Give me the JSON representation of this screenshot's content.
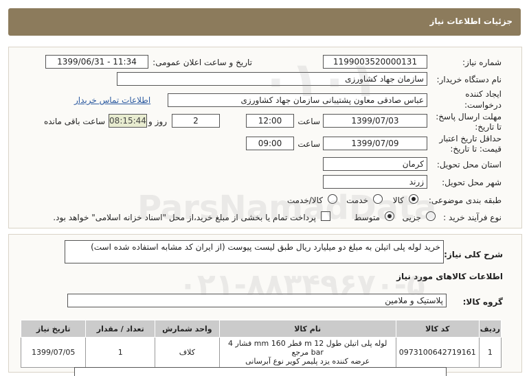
{
  "header": {
    "title": "جزئیات اطلاعات نیاز"
  },
  "form": {
    "need_number_label": "شماره نیاز:",
    "need_number": "1199003520000131",
    "announce_label": "تاریخ و ساعت اعلان عمومی:",
    "announce_value": "1399/06/31 - 11:34",
    "buyer_label": "نام دستگاه خریدار:",
    "buyer_value": "سازمان جهاد کشاورزی",
    "creator_label_1": "ایجاد کننده",
    "creator_label_2": "درخواست:",
    "creator_value": "عباس صادقی معاون پشتیبانی سازمان جهاد کشاورزی",
    "contact_link": "اطلاعات تماس خریدار",
    "deadline_label_1": "مهلت ارسال پاسخ:",
    "deadline_label_2": "تا تاریخ:",
    "deadline_date": "1399/07/03",
    "time_label": "ساعت",
    "deadline_time": "12:00",
    "days_value": "2",
    "days_label": "روز و",
    "remaining_time": "08:15:44",
    "remaining_label": "ساعت باقی مانده",
    "validity_label_1": "حداقل تاریخ اعتبار",
    "validity_label_2": "قیمت: تا تاریخ:",
    "validity_date": "1399/07/09",
    "validity_time": "09:00",
    "province_label": "استان محل تحویل:",
    "province_value": "کرمان",
    "city_label": "شهر محل تحویل:",
    "city_value": "زرند",
    "category_label": "طبقه بندی موضوعی:",
    "category_options": [
      "کالا",
      "خدمت",
      "کالا/خدمت"
    ],
    "category_selected": "کالا",
    "process_label": "نوع فرآیند خرید :",
    "process_options": [
      "جزیی",
      "متوسط"
    ],
    "process_selected": "متوسط",
    "payment_note": "پرداخت تمام یا بخشی از مبلغ خرید،از محل \"اسناد خزانه اسلامی\" خواهد بود."
  },
  "description": {
    "label": "شرح کلی نیاز:",
    "value": "خرید لوله پلی اتیلن به مبلغ دو میلیارد ریال طبق لیست پیوست (از ایران کد مشابه استفاده شده است)"
  },
  "goods_section": {
    "title": "اطلاعات کالاهای مورد نیاز",
    "group_label": "گروه کالا:",
    "group_value": "پلاستیک و ملامین",
    "columns": [
      "ردیف",
      "کد کالا",
      "نام کالا",
      "واحد شمارش",
      "تعداد / مقدار",
      "تاریخ نیاز"
    ],
    "rows": [
      {
        "row": "1",
        "code": "0973100642719161",
        "name_line1": "لوله پلی اتیلن طول 12 m قطر 160 mm فشار 4 bar مرجع",
        "name_line2": "عرضه کننده یزد پلیمر کویر نوع آبرسانی",
        "unit": "کلاف",
        "qty": "1",
        "date": "1399/07/05"
      }
    ]
  },
  "colors": {
    "header": "#8c7b5c",
    "link": "#2c5aa0",
    "table_header": "#cbcbcb"
  }
}
